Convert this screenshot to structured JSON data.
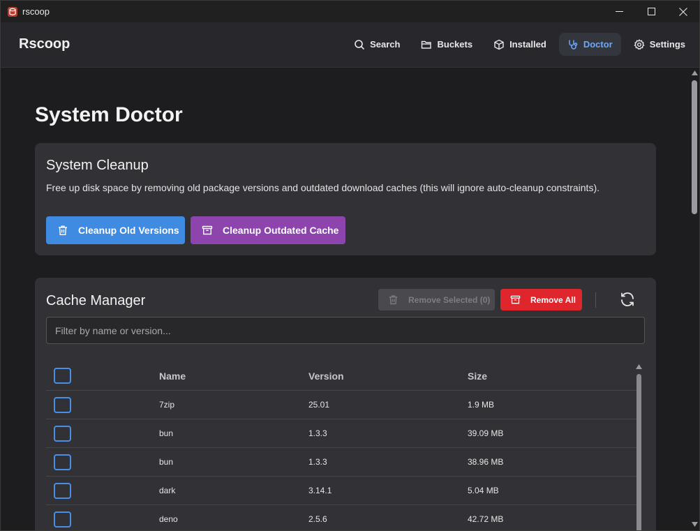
{
  "window": {
    "title": "rscoop"
  },
  "header": {
    "brand": "Rscoop",
    "nav": [
      {
        "label": "Search",
        "icon": "search-icon"
      },
      {
        "label": "Buckets",
        "icon": "folder-icon"
      },
      {
        "label": "Installed",
        "icon": "package-icon"
      },
      {
        "label": "Doctor",
        "icon": "stethoscope-icon",
        "active": true
      },
      {
        "label": "Settings",
        "icon": "gear-icon"
      }
    ]
  },
  "page": {
    "title": "System Doctor"
  },
  "cleanup": {
    "title": "System Cleanup",
    "description": "Free up disk space by removing old package versions and outdated download caches (this will ignore auto-cleanup constraints).",
    "old_versions_label": "Cleanup Old Versions",
    "outdated_cache_label": "Cleanup Outdated Cache"
  },
  "cache": {
    "title": "Cache Manager",
    "remove_selected_label": "Remove Selected (0)",
    "remove_all_label": "Remove All",
    "filter_placeholder": "Filter by name or version...",
    "columns": {
      "name": "Name",
      "version": "Version",
      "size": "Size"
    },
    "rows": [
      {
        "name": "7zip",
        "version": "25.01",
        "size": "1.9 MB"
      },
      {
        "name": "bun",
        "version": "1.3.3",
        "size": "39.09 MB"
      },
      {
        "name": "bun",
        "version": "1.3.3",
        "size": "38.96 MB"
      },
      {
        "name": "dark",
        "version": "3.14.1",
        "size": "5.04 MB"
      },
      {
        "name": "deno",
        "version": "2.5.6",
        "size": "42.72 MB"
      }
    ]
  },
  "colors": {
    "accent": "#6ea8fe",
    "blue_button": "#3f8be2",
    "purple_button": "#8e44ad",
    "red_button": "#e0262d"
  }
}
